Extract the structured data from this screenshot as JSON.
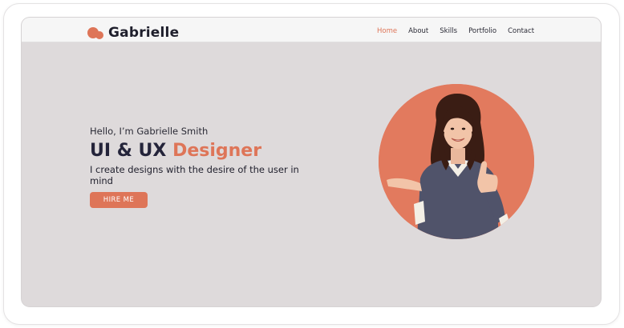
{
  "brand": {
    "name": "Gabrielle",
    "logo_icon": "two-circle-logo-icon",
    "accent_color": "#de7558"
  },
  "nav": {
    "items": [
      {
        "label": "Home",
        "active": true
      },
      {
        "label": "About",
        "active": false
      },
      {
        "label": "Skills",
        "active": false
      },
      {
        "label": "Portfolio",
        "active": false
      },
      {
        "label": "Contact",
        "active": false
      }
    ]
  },
  "hero": {
    "greeting": "Hello, I’m Gabrielle Smith",
    "headline_primary": "UI & UX",
    "headline_accent": "Designer",
    "tagline": "I create designs with the desire of the user in mind",
    "cta_label": "HIRE ME",
    "portrait_icon": "woman-thumbs-up-portrait",
    "portrait_bg_color": "#e27a5e"
  },
  "colors": {
    "page_bg": "#dedadb",
    "navbar_bg": "#f6f6f6",
    "text_dark": "#24243a"
  }
}
